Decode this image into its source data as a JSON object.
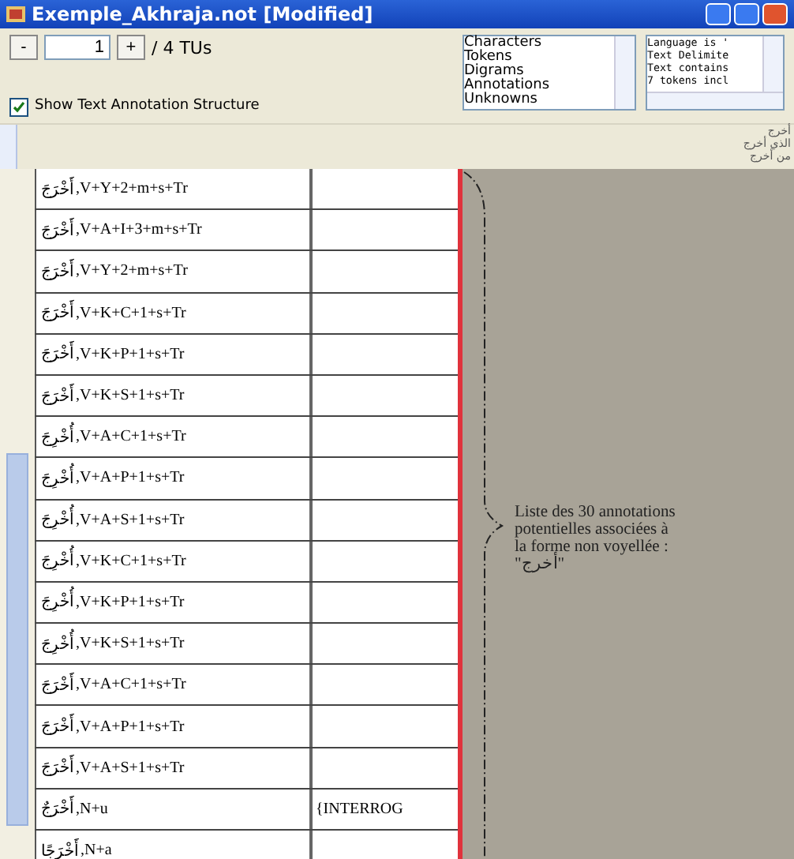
{
  "window": {
    "title": "Exemple_Akhraja.not [Modified]"
  },
  "navigator": {
    "minus": "-",
    "page": "1",
    "plus": "+",
    "total": "/ 4 TUs"
  },
  "show_structure": {
    "label": "Show Text Annotation Structure",
    "checked": true
  },
  "view_list": {
    "items": [
      {
        "label": "Characters",
        "selected": false
      },
      {
        "label": "Tokens",
        "selected": false
      },
      {
        "label": "Digrams",
        "selected": false
      },
      {
        "label": "Annotations",
        "selected": false
      },
      {
        "label": "Unknowns",
        "selected": false
      }
    ]
  },
  "info_box": {
    "lines": [
      "Language is '",
      "Text Delimite",
      "Text contains",
      "7 tokens incl"
    ]
  },
  "text_strip": {
    "lines": [
      "أخرج",
      "الذي أخرج",
      "من أخرج"
    ]
  },
  "table": {
    "rows": [
      {
        "form": "أَخْرَجَ",
        "code": ",V+Y+2+m+s+Tr",
        "column_2": ""
      },
      {
        "form": "أَخْرَجَ",
        "code": ",V+A+I+3+m+s+Tr",
        "column_2": ""
      },
      {
        "form": "أَخْرَجَ",
        "code": ",V+Y+2+m+s+Tr",
        "column_2": ""
      },
      {
        "form": "أَخْرَجَ",
        "code": ",V+K+C+1+s+Tr",
        "column_2": ""
      },
      {
        "form": "أَخْرَجَ",
        "code": ",V+K+P+1+s+Tr",
        "column_2": ""
      },
      {
        "form": "أَخْرَجَ",
        "code": ",V+K+S+1+s+Tr",
        "column_2": ""
      },
      {
        "form": "أُخْرِجَ",
        "code": ",V+A+C+1+s+Tr",
        "column_2": ""
      },
      {
        "form": "أُخْرِجَ",
        "code": ",V+A+P+1+s+Tr",
        "column_2": ""
      },
      {
        "form": "أُخْرِجَ",
        "code": ",V+A+S+1+s+Tr",
        "column_2": ""
      },
      {
        "form": "أُخْرِجَ",
        "code": ",V+K+C+1+s+Tr",
        "column_2": ""
      },
      {
        "form": "أُخْرِجَ",
        "code": ",V+K+P+1+s+Tr",
        "column_2": ""
      },
      {
        "form": "أُخْرِجَ",
        "code": ",V+K+S+1+s+Tr",
        "column_2": ""
      },
      {
        "form": "أَخْرَجَ",
        "code": ",V+A+C+1+s+Tr",
        "column_2": ""
      },
      {
        "form": "أَخْرَجَ",
        "code": ",V+A+P+1+s+Tr",
        "column_2": ""
      },
      {
        "form": "أَخْرَجَ",
        "code": ",V+A+S+1+s+Tr",
        "column_2": ""
      },
      {
        "form": "أَخْرَجٌ",
        "code": ",N+u",
        "column_2": "{INTERROG"
      },
      {
        "form": "أَخْرَجًا",
        "code": ",N+a",
        "column_2": ""
      }
    ]
  },
  "annotation": {
    "lines": [
      "Liste des 30 annotations",
      "potentielles associées à",
      "la forme non voyellée :",
      "\"أخرج\""
    ]
  }
}
